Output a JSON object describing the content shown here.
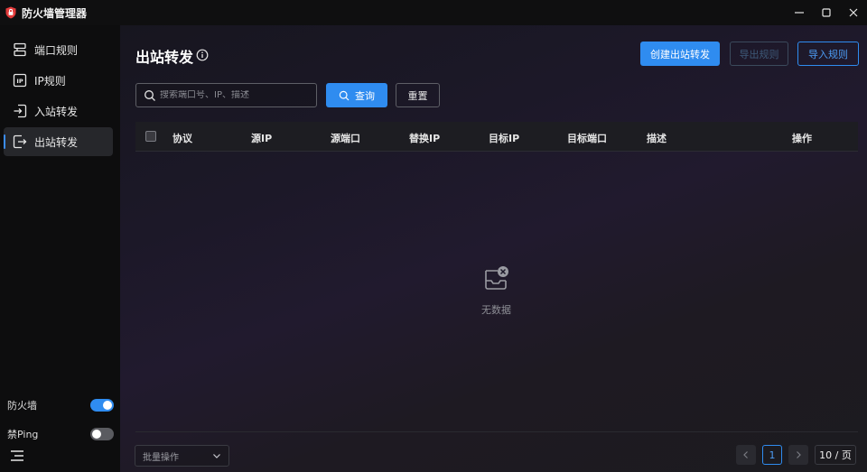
{
  "app": {
    "title": "防火墙管理器",
    "accent": "#2f8cf0",
    "logo_icon": "shield-icon"
  },
  "window_controls": [
    "minimize-icon",
    "maximize-icon",
    "close-icon"
  ],
  "sidebar": {
    "items": [
      {
        "label": "端口规则",
        "icon": "port-rules-icon",
        "active": false
      },
      {
        "label": "IP规则",
        "icon": "ip-icon",
        "active": false
      },
      {
        "label": "入站转发",
        "icon": "inbound-icon",
        "active": false
      },
      {
        "label": "出站转发",
        "icon": "outbound-icon",
        "active": true
      }
    ],
    "toggles": [
      {
        "label": "防火墙",
        "on": true
      },
      {
        "label": "禁Ping",
        "on": false
      }
    ],
    "menu_icon": "menu-icon"
  },
  "main": {
    "title": "出站转发",
    "toolbar": {
      "create_label": "创建出站转发",
      "export_label": "导出规则",
      "import_label": "导入规则"
    },
    "search": {
      "placeholder": "搜索端口号、IP、描述",
      "query_label": "查询",
      "reset_label": "重置"
    },
    "table": {
      "columns": [
        "协议",
        "源IP",
        "源端口",
        "替换IP",
        "目标IP",
        "目标端口",
        "描述",
        "操作"
      ],
      "rows": [],
      "empty_text": "无数据"
    },
    "footer": {
      "batch_label": "批量操作",
      "current_page": "1",
      "page_size": "10 / 页"
    }
  }
}
